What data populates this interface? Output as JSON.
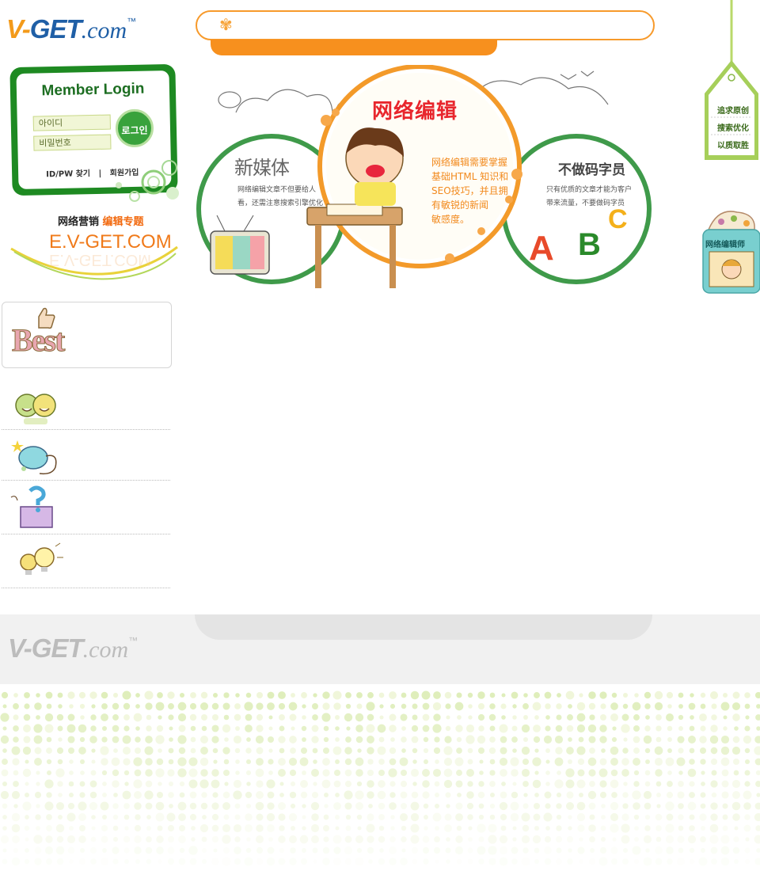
{
  "brand": {
    "logo_v": "V-",
    "logo_get": "GET",
    "logo_com": ".com",
    "logo_tm": "™"
  },
  "search": {
    "placeholder": ""
  },
  "login": {
    "title": "Member Login",
    "id_placeholder": "아이디",
    "pw_placeholder": "비밀번호",
    "button_label": "로그인",
    "find_link": "ID/PW 찾기",
    "separator": "|",
    "join_link": "회원가입"
  },
  "marketing": {
    "label_a": "网络营销",
    "label_b": "编辑专题",
    "url": "E.V-GET.COM"
  },
  "best": {
    "label": "Best"
  },
  "banner": {
    "center_title": "网络编辑",
    "center_text": [
      "网络编辑需要掌握",
      "基础HTML 知识和",
      "SEO技巧，并且拥",
      "有敏锐的新闻",
      "敏感度。"
    ],
    "left_title": "新媒体",
    "left_text": [
      "网络编辑文章不但要给人",
      "看，还需注意搜索引擎优化"
    ],
    "right_title": "不做码字员",
    "right_text": [
      "只有优质的文章才能为客户",
      "带来流量，不要做码字员"
    ],
    "abc": [
      "A",
      "B",
      "C"
    ]
  },
  "tags": {
    "tag1": [
      "追求原创",
      "搜索优化",
      "以质取胜"
    ],
    "tag2": "网络编辑师"
  },
  "colors": {
    "orange": "#f7901e",
    "green": "#1e8a22",
    "blue": "#1f5fa6",
    "red": "#e8262d"
  }
}
